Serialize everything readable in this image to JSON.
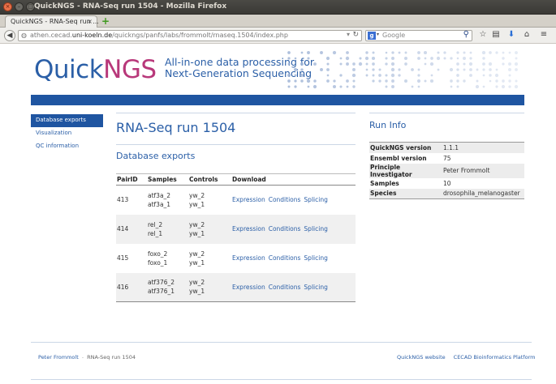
{
  "window": {
    "title": "QuickNGS - RNA-Seq run 1504 - Mozilla Firefox"
  },
  "tab": {
    "label": "QuickNGS - RNA-Seq run ...",
    "close": "×",
    "new_tab": "+"
  },
  "navbar": {
    "url_prefix": "athen.cecad.",
    "url_domain": "uni-koeln.de",
    "url_path": "/quickngs/panfs/labs/frommolt/rnaseq.1504/index.php",
    "search_engine": "g",
    "search_placeholder": "Google"
  },
  "header": {
    "logo_quick": "Quick",
    "logo_ngs": "NGS",
    "tagline_line1": "All-in-one data processing for",
    "tagline_line2": "Next-Generation Sequencing",
    "colors": {
      "brand_blue": "#2b5fa7",
      "brand_pink": "#b8387a",
      "bar_blue": "#1f55a1"
    }
  },
  "sidebar": {
    "items": [
      {
        "label": "Database exports",
        "active": true
      },
      {
        "label": "Visualization",
        "active": false
      },
      {
        "label": "QC information",
        "active": false
      }
    ]
  },
  "main": {
    "title": "RNA-Seq run 1504",
    "section_title": "Database exports",
    "table": {
      "headers": [
        "PairID",
        "Samples",
        "Controls",
        "Download"
      ],
      "rows": [
        {
          "pair_id": "413",
          "samples": [
            "atf3a_2",
            "atf3a_1"
          ],
          "controls": [
            "yw_2",
            "yw_1"
          ],
          "links": [
            "Expression",
            "Conditions",
            "Splicing"
          ]
        },
        {
          "pair_id": "414",
          "samples": [
            "rel_2",
            "rel_1"
          ],
          "controls": [
            "yw_2",
            "yw_1"
          ],
          "links": [
            "Expression",
            "Conditions",
            "Splicing"
          ]
        },
        {
          "pair_id": "415",
          "samples": [
            "foxo_2",
            "foxo_1"
          ],
          "controls": [
            "yw_2",
            "yw_1"
          ],
          "links": [
            "Expression",
            "Conditions",
            "Splicing"
          ]
        },
        {
          "pair_id": "416",
          "samples": [
            "atf376_2",
            "atf376_1"
          ],
          "controls": [
            "yw_2",
            "yw_1"
          ],
          "links": [
            "Expression",
            "Conditions",
            "Splicing"
          ]
        }
      ]
    }
  },
  "run_info": {
    "title": "Run Info",
    "rows": [
      {
        "key": "QuickNGS version",
        "value": "1.1.1"
      },
      {
        "key": "Ensembl version",
        "value": "75"
      },
      {
        "key": "Principle Investigator",
        "value": "Peter Frommolt"
      },
      {
        "key": "Samples",
        "value": "10"
      },
      {
        "key": "Species",
        "value": "drosophila_melanogaster"
      }
    ]
  },
  "footer": {
    "author": "Peter Frommolt",
    "separator": "-",
    "page": "RNA-Seq run 1504",
    "links": [
      "QuickNGS website",
      "CECAD Bioinformatics Platform"
    ]
  }
}
